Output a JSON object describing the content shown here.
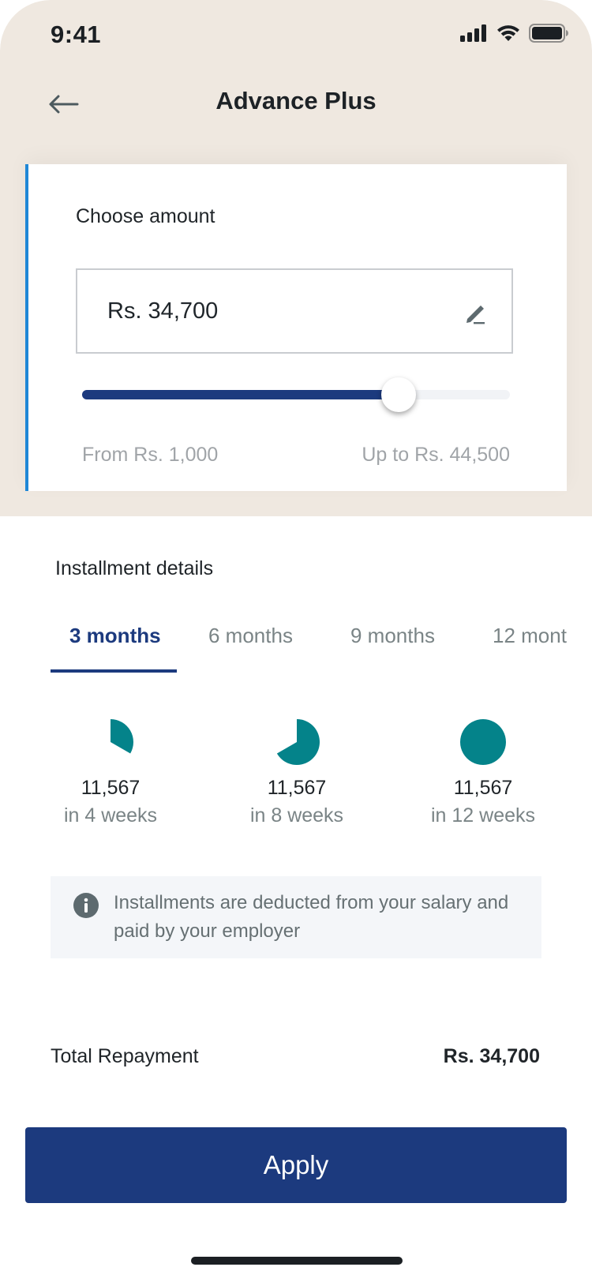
{
  "status_bar": {
    "time": "9:41"
  },
  "header": {
    "title": "Advance Plus"
  },
  "amount_card": {
    "label": "Choose amount",
    "amount_value": "Rs. 34,700",
    "slider_level": 0.74,
    "range_min": "From Rs. 1,000",
    "range_max": "Up to Rs. 44,500"
  },
  "installments": {
    "title": "Installment details",
    "tabs": [
      {
        "label": "3 months",
        "active": true
      },
      {
        "label": "6 months",
        "active": false
      },
      {
        "label": "9 months",
        "active": false
      },
      {
        "label": "12 mont",
        "active": false
      }
    ],
    "schedule": [
      {
        "amount": "11,567",
        "weeks": "in 4 weeks",
        "progress": 0.3333
      },
      {
        "amount": "11,567",
        "weeks": "in 8 weeks",
        "progress": 0.6667
      },
      {
        "amount": "11,567",
        "weeks": "in 12 weeks",
        "progress": 1.0
      }
    ],
    "info_text": "Installments are deducted from your salary and paid by your employer"
  },
  "total": {
    "label": "Total Repayment",
    "value": "Rs. 34,700"
  },
  "apply_label": "Apply",
  "colors": {
    "primary": "#1c3a7e",
    "accent_bar": "#1f87d6",
    "pie": "#04838a",
    "header_bg": "#efe8e0"
  },
  "icons": [
    "back-arrow-icon",
    "edit-pencil-icon",
    "info-icon",
    "signal-icon",
    "wifi-icon",
    "battery-icon"
  ]
}
